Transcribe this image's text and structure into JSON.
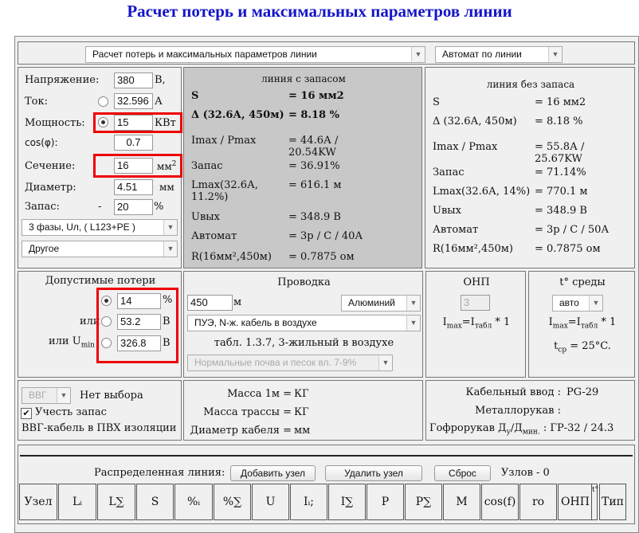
{
  "title": "Расчет потерь и максимальных параметров линии",
  "top": {
    "mode_select": "Расчет потерь и максимальных параметров линии",
    "breaker_select": "Автомат по линии"
  },
  "inputs": {
    "voltage_label": "Напряжение:",
    "voltage": "380",
    "voltage_unit": "В,",
    "current_label": "Ток:",
    "current": "32.596",
    "current_unit": "А",
    "power_label": "Мощность:",
    "power": "15",
    "power_unit": "КВт",
    "cos_label": "cos(φ):",
    "cos": "0.7",
    "section_label": "Сечение:",
    "section": "16",
    "section_unit": "мм",
    "diameter_label": "Диаметр:",
    "diameter": "4.51",
    "diameter_unit": "мм",
    "reserve_label": "Запас:",
    "reserve_sign": "-",
    "reserve": "20",
    "reserve_unit": "%",
    "phase_select": "3 фазы, Uл,  ( L123+PE )",
    "other_select": "Другое"
  },
  "with_reserve": {
    "title": "линия с запасом",
    "rows": [
      {
        "k": "S",
        "v": "= 16 мм2"
      },
      {
        "k": "Δ (32.6А, 450м)",
        "v": "= 8.18 %"
      },
      {
        "k": "Imax / Pmax",
        "v": "= 44.6А / 20.54KW"
      },
      {
        "k": "Запас",
        "v": "= 36.91%"
      },
      {
        "k": "Lmax(32.6А, 11.2%)",
        "v": "= 616.1 м"
      },
      {
        "k": "Uвых",
        "v": "= 348.9 В"
      },
      {
        "k": "Автомат",
        "v": "= 3р / С / 40А"
      },
      {
        "k": "R(16мм²,450м)",
        "v": "= 0.7875 ом"
      }
    ]
  },
  "without_reserve": {
    "title": "линия без запаса",
    "rows": [
      {
        "k": "S",
        "v": "= 16 мм2"
      },
      {
        "k": "Δ (32.6А, 450м)",
        "v": "= 8.18 %"
      },
      {
        "k": "Imax / Pmax",
        "v": "= 55.8А / 25.67KW"
      },
      {
        "k": "Запас",
        "v": "= 71.14%"
      },
      {
        "k": "Lmax(32.6А, 14%)",
        "v": "= 770.1 м"
      },
      {
        "k": "Uвых",
        "v": "= 348.9 В"
      },
      {
        "k": "Автомат",
        "v": "= 3р / С / 50А"
      },
      {
        "k": "R(16мм²,450м)",
        "v": "= 0.7875 ом"
      }
    ]
  },
  "losses": {
    "title": "Допустимые потери",
    "pct": "14",
    "pct_unit": "%",
    "or1": "или",
    "volt": "53.2",
    "volt_unit": "В",
    "or2": "или U",
    "or2_sub": "min",
    "umin": "326.8",
    "umin_unit": "В"
  },
  "wiring": {
    "title": "Проводка",
    "length": "450",
    "length_unit": "м",
    "material": "Алюминий",
    "method": "ПУЭ, N-ж. кабель в воздухе",
    "table_note": "табл. 1.3.7, 3-жильный в воздухе",
    "soil": "Нормальные почва и песок вл. 7-9%"
  },
  "onp": {
    "title": "ОНП",
    "value": "3",
    "formula": "I",
    "f_sub1": "max",
    "f_eq": "=I",
    "f_sub2": "табл",
    "f_tail": " * 1"
  },
  "temp": {
    "title": "t° среды",
    "select": "авто",
    "formula": "I",
    "f_sub1": "max",
    "f_eq": "=I",
    "f_sub2": "табл",
    "f_tail": " * 1",
    "tcp": "t",
    "tcp_sub": "ср",
    "tcp_val": " = 25°C."
  },
  "cable": {
    "type": "ВВГ",
    "no_choice": "Нет выбора",
    "account_reserve": "Учесть запас",
    "desc": "ВВГ-кабель в ПВХ изоляции"
  },
  "mass": {
    "m1_label": "Масса 1м =",
    "m1_unit": "КГ",
    "route_label": "Масса трассы =",
    "route_unit": "КГ",
    "diam_label": "Диаметр кабеля =",
    "diam_unit": "мм"
  },
  "entry": {
    "gland_label": "Кабельный ввод :",
    "gland": "PG-29",
    "metal_label": "Металлорукав :",
    "corr_label": "Гофрорукав Д",
    "corr_sub1": "у",
    "corr_mid": "/Д",
    "corr_sub2": "мин.",
    "corr_val": " : ГР-32 / 24.3"
  },
  "distributed": {
    "label": "Распределенная линия:",
    "add": "Добавить узел",
    "remove": "Удалить узел",
    "reset": "Сброс",
    "count": "Узлов - 0",
    "headers": [
      "Узел",
      "Lᵢ",
      "L∑",
      "S",
      "%ᵢ",
      "%∑",
      "U",
      "Iᵢ;",
      "I∑",
      "P",
      "P∑",
      "M",
      "cos(f)",
      "ro",
      "ОНП",
      "t°",
      "Тип"
    ]
  }
}
